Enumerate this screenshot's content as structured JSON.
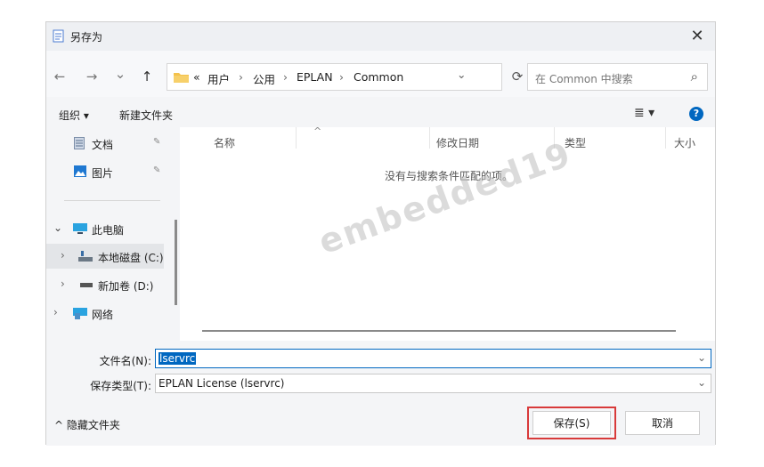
{
  "window": {
    "title": "另存为",
    "close_glyph": "✕"
  },
  "nav": {
    "back_glyph": "←",
    "forward_glyph": "→",
    "history_glyph": "⌄",
    "up_glyph": "↑",
    "breadcrumb": [
      {
        "label": "«"
      },
      {
        "label": "用户"
      },
      {
        "label": "公用"
      },
      {
        "label": "EPLAN"
      },
      {
        "label": "Common"
      }
    ],
    "crumb_sep": "›",
    "dropdown_glyph": "⌄",
    "refresh_glyph": "⟳",
    "search_placeholder": "在 Common 中搜索",
    "search_glyph": "⌕"
  },
  "toolbar": {
    "organize": "组织 ▾",
    "new_folder": "新建文件夹",
    "view_glyph": "≣ ▾",
    "help_glyph": "?"
  },
  "sidebar": {
    "items": [
      {
        "label": "文档",
        "pin": "📌",
        "icon": "document-icon"
      },
      {
        "label": "图片",
        "pin": "📌",
        "icon": "picture-icon"
      },
      {
        "label": "此电脑",
        "chevron": "⌄",
        "icon": "computer-icon"
      },
      {
        "label": "本地磁盘 (C:)",
        "chevron": "›",
        "icon": "drive-icon"
      },
      {
        "label": "新加卷 (D:)",
        "chevron": "›",
        "icon": "volume-icon"
      },
      {
        "label": "网络",
        "chevron": "›",
        "icon": "network-icon"
      }
    ]
  },
  "columns": {
    "name": "名称",
    "modified": "修改日期",
    "type": "类型",
    "size": "大小",
    "sort_glyph": "^"
  },
  "empty_message": "没有与搜索条件匹配的项。",
  "watermark": "embedded19",
  "form": {
    "filename_label": "文件名(N):",
    "filename_value": "lservrc",
    "filetype_label": "保存类型(T):",
    "filetype_value": "EPLAN License (lservrc)",
    "dropdown_glyph": "⌄"
  },
  "footer": {
    "hide_folders": "^ 隐藏文件夹",
    "save": "保存(S)",
    "cancel": "取消"
  },
  "colors": {
    "accent": "#0067c0",
    "highlight": "#d83a3a",
    "folder": "#f4c24c"
  }
}
